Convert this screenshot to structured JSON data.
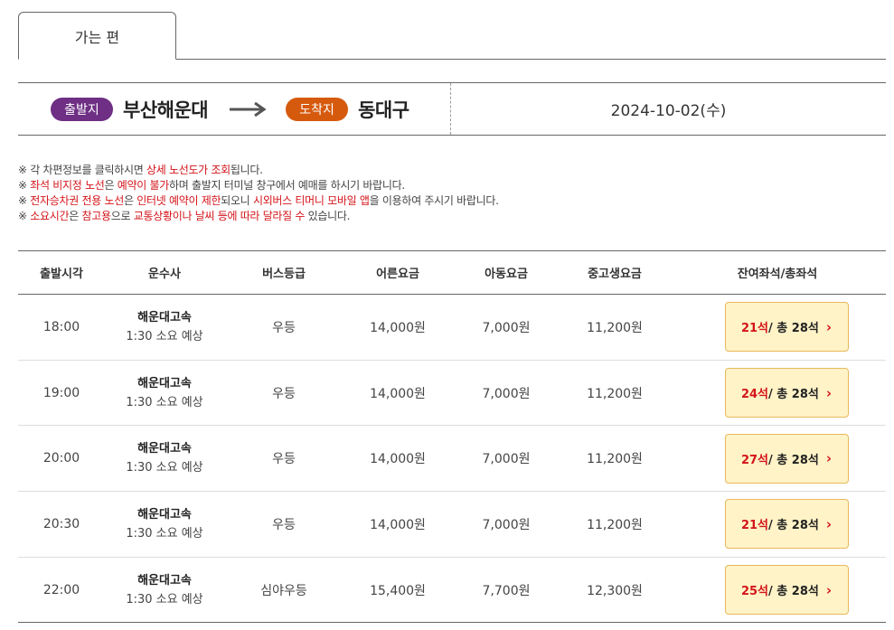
{
  "tab": {
    "label": "가는 편"
  },
  "route": {
    "departure_badge": "출발지",
    "departure": "부산해운대",
    "arrival_badge": "도착지",
    "arrival": "동대구",
    "date": "2024-10-02(수)"
  },
  "notices": [
    [
      "※ 각 차편정보를 클릭하시면 ",
      "상세 노선도가 조회",
      "됩니다.",
      "",
      "",
      "",
      ""
    ],
    [
      "※ ",
      "좌석 비지정 노선",
      "은 ",
      "예약이 불가",
      "하며 출발지 터미널 창구에서 예매를 하시기 바랍니다.",
      "",
      ""
    ],
    [
      "※ ",
      "전자승차권 전용 노선",
      "은 ",
      "인터넷 예약이 제한",
      "되오니 ",
      "시외버스 티머니 모바일 앱",
      "을 이용하여 주시기 바랍니다."
    ],
    [
      "※ ",
      "소요시간",
      "은 ",
      "참고용",
      "으로 ",
      "교통상황이나 날씨 등에 따라 달라질 수",
      " 있습니다."
    ]
  ],
  "table": {
    "headers": [
      "출발시각",
      "운수사",
      "버스등급",
      "어른요금",
      "아동요금",
      "중고생요금",
      "잔여좌석/총좌석"
    ],
    "rows": [
      {
        "time": "18:00",
        "company": "해운대고속",
        "duration": "1:30 소요 예상",
        "grade": "우등",
        "adult": "14,000원",
        "child": "7,000원",
        "youth": "11,200원",
        "seats_left": "21석",
        "seats_total": " / 총 28석"
      },
      {
        "time": "19:00",
        "company": "해운대고속",
        "duration": "1:30 소요 예상",
        "grade": "우등",
        "adult": "14,000원",
        "child": "7,000원",
        "youth": "11,200원",
        "seats_left": "24석",
        "seats_total": " / 총 28석"
      },
      {
        "time": "20:00",
        "company": "해운대고속",
        "duration": "1:30 소요 예상",
        "grade": "우등",
        "adult": "14,000원",
        "child": "7,000원",
        "youth": "11,200원",
        "seats_left": "27석",
        "seats_total": " / 총 28석"
      },
      {
        "time": "20:30",
        "company": "해운대고속",
        "duration": "1:30 소요 예상",
        "grade": "우등",
        "adult": "14,000원",
        "child": "7,000원",
        "youth": "11,200원",
        "seats_left": "21석",
        "seats_total": " / 총 28석"
      },
      {
        "time": "22:00",
        "company": "해운대고속",
        "duration": "1:30 소요 예상",
        "grade": "심야우등",
        "adult": "15,400원",
        "child": "7,700원",
        "youth": "12,300원",
        "seats_left": "25석",
        "seats_total": " / 총 28석"
      }
    ]
  },
  "icons": {
    "route_arrow": "right-arrow-icon",
    "row_chevron": "chevron-right-icon"
  },
  "colors": {
    "departure_badge": "#6e2f84",
    "arrival_badge": "#d65a0e",
    "highlight": "#d4141a",
    "seat_button_bg": "#fff3c7",
    "seat_button_border": "#e9b95d"
  }
}
